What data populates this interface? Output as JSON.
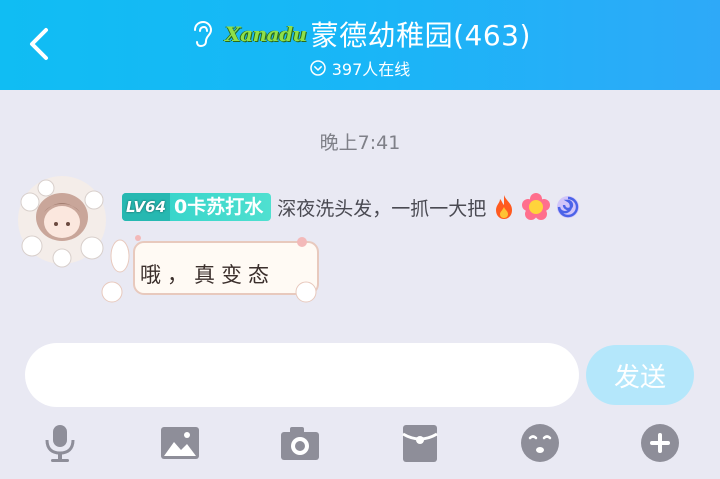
{
  "header": {
    "brand_text": "Xanadu",
    "title": "蒙德幼稚园(463)",
    "online": "397人在线"
  },
  "chat": {
    "time": "晚上7:41",
    "message": {
      "level": "LV64",
      "nickname": "0卡苏打水",
      "signature": "深夜洗头发，一抓一大把",
      "bubble_text": "哦，真变态"
    }
  },
  "input": {
    "placeholder": "",
    "send_label": "发送"
  },
  "toolbar": [
    "microphone-icon",
    "image-icon",
    "camera-icon",
    "red-packet-icon",
    "emoji-icon",
    "plus-icon"
  ],
  "colors": {
    "header": "#19b6f7",
    "send_button": "#b4e7fb",
    "background": "#e9e9f3",
    "level_badge": "#2fd0c8"
  }
}
